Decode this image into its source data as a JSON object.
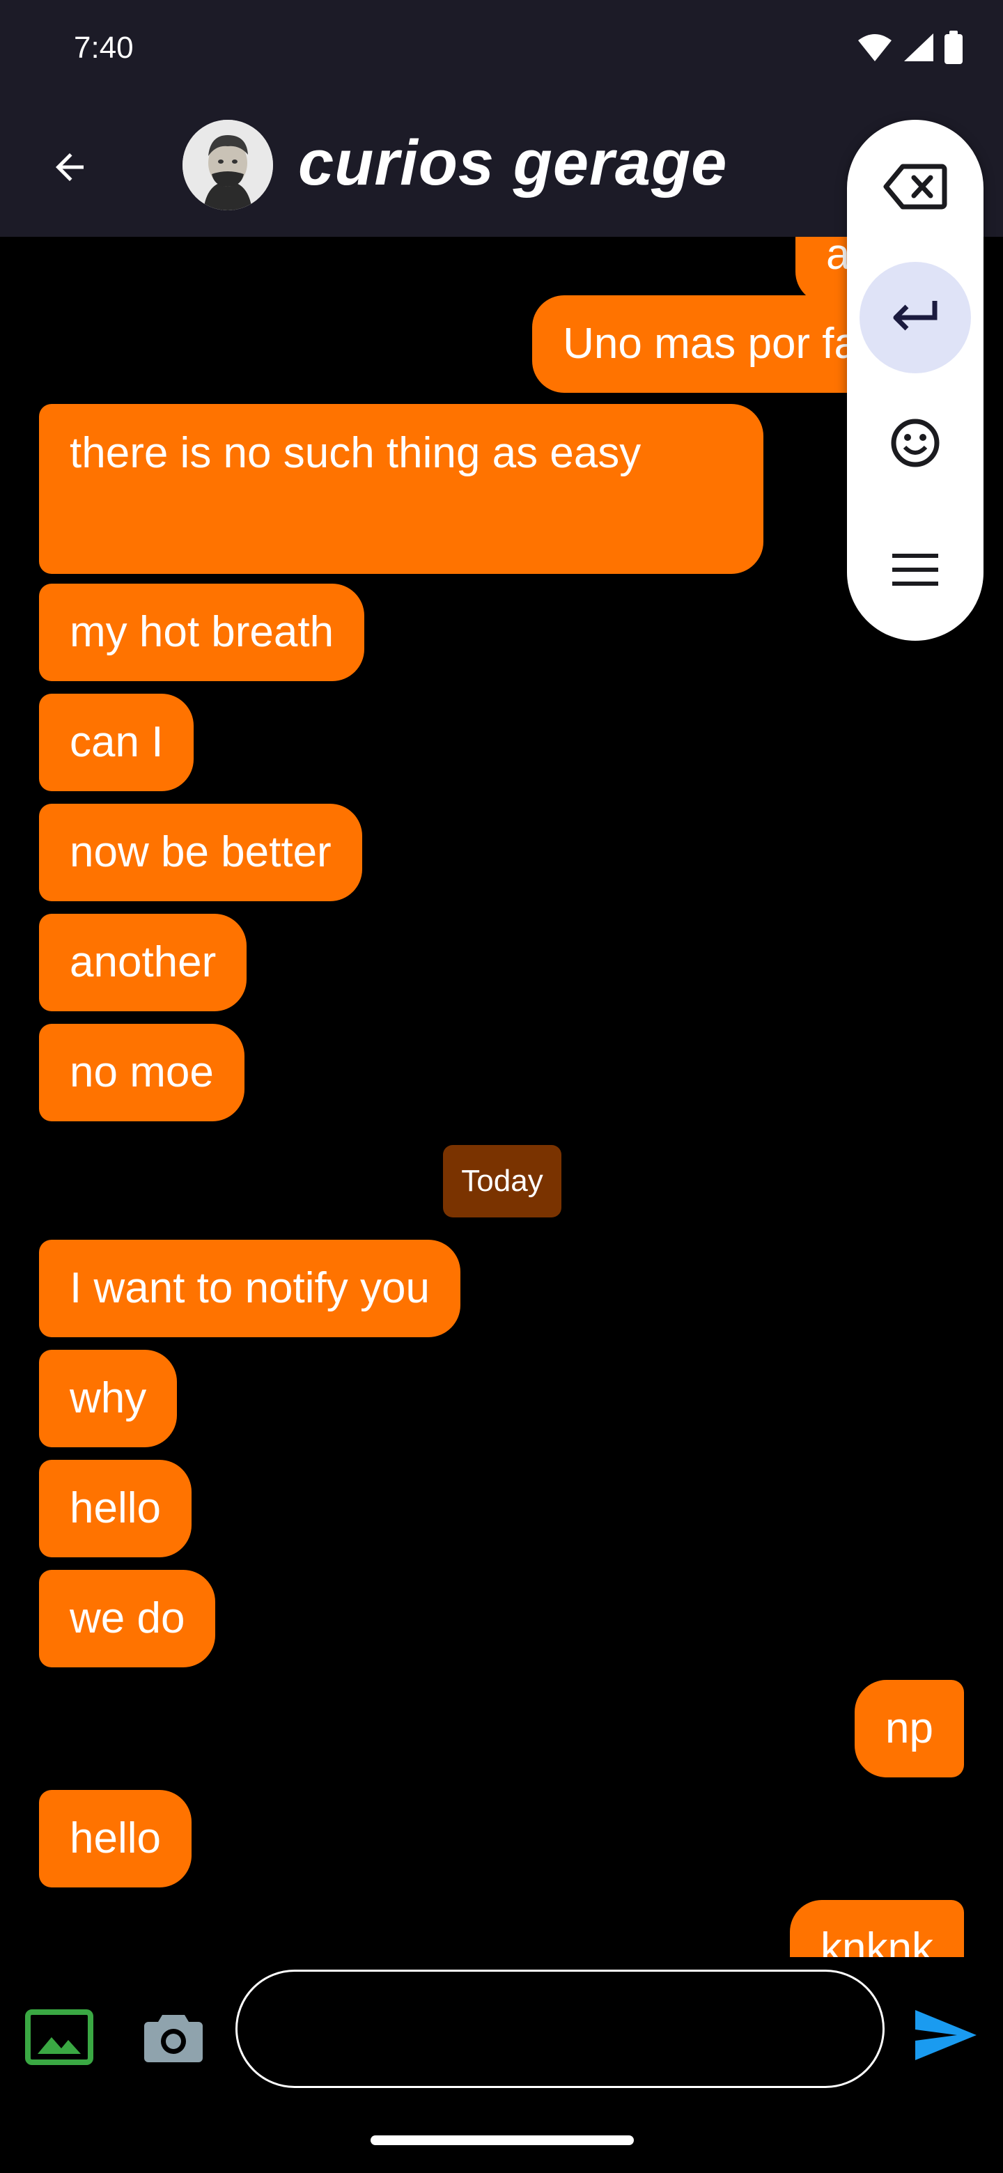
{
  "status_bar": {
    "time": "7:40",
    "icons": [
      "wifi-icon",
      "signal-icon",
      "battery-icon"
    ]
  },
  "header": {
    "title": "curios gerage",
    "back_icon": "arrow-left-icon",
    "avatar": "contact-avatar"
  },
  "messages": [
    {
      "text": "ag",
      "side": "right"
    },
    {
      "text": "Uno mas por fa",
      "side": "right"
    },
    {
      "text": "there is no such thing as easy",
      "side": "left"
    },
    {
      "text": "my hot breath",
      "side": "left"
    },
    {
      "text": "can I",
      "side": "left"
    },
    {
      "text": "now be better",
      "side": "left"
    },
    {
      "text": "another",
      "side": "left"
    },
    {
      "text": "no moe",
      "side": "left"
    },
    {
      "text": "I want to notify you",
      "side": "left"
    },
    {
      "text": "why",
      "side": "left"
    },
    {
      "text": "hello",
      "side": "left"
    },
    {
      "text": "we do",
      "side": "left"
    },
    {
      "text": "np",
      "side": "right"
    },
    {
      "text": "hello",
      "side": "left"
    },
    {
      "text": "knknk",
      "side": "right"
    }
  ],
  "date_separator": "Today",
  "floating_toolbar": {
    "items": [
      "backspace-icon",
      "enter-icon",
      "emoji-icon",
      "menu-icon"
    ],
    "active": "enter-icon"
  },
  "input_bar": {
    "gallery_icon": "gallery-icon",
    "camera_icon": "camera-icon",
    "message_value": "",
    "message_placeholder": "",
    "send_icon": "send-icon"
  },
  "colors": {
    "bubble": "#ff7300",
    "date_chip": "#7a3300",
    "app_bar": "#1c1b27",
    "send": "#1a9bf0",
    "gallery": "#3aa843",
    "camera": "#8fa3ad"
  }
}
